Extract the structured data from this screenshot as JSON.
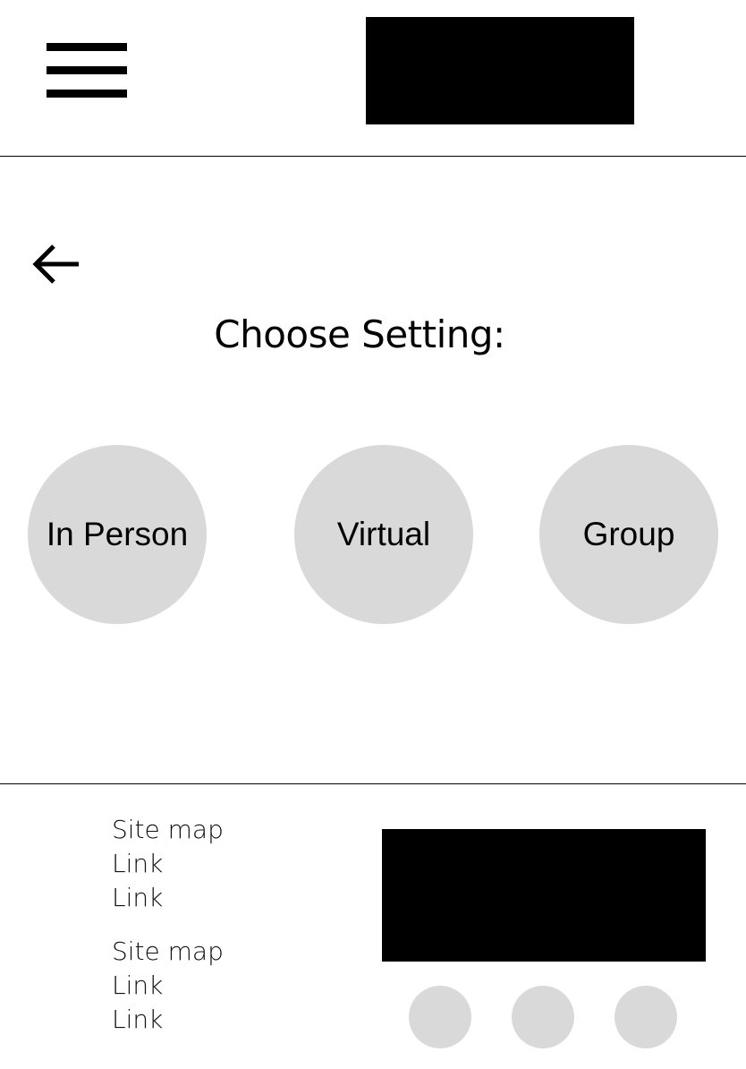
{
  "header": {
    "menu_icon": "hamburger-menu-icon",
    "logo": "logo-placeholder"
  },
  "main": {
    "back_icon": "back-arrow-icon",
    "title": "Choose Setting:",
    "options": [
      {
        "label": "In Person"
      },
      {
        "label": "Virtual"
      },
      {
        "label": "Group"
      }
    ]
  },
  "footer": {
    "columns": [
      {
        "heading": "Site map",
        "links": [
          "Link",
          "Link"
        ]
      },
      {
        "heading": "Site map",
        "links": [
          "Link",
          "Link"
        ]
      }
    ],
    "image": "footer-image-placeholder",
    "social_icons": [
      "social-icon-1",
      "social-icon-2",
      "social-icon-3"
    ]
  },
  "colors": {
    "placeholder_dark": "#000000",
    "option_fill": "#d9d9d9",
    "background": "#ffffff"
  }
}
